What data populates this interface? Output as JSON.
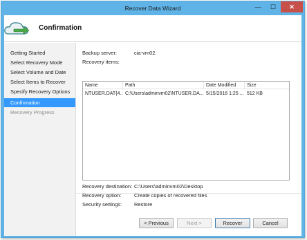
{
  "window": {
    "title": "Recover Data Wizard",
    "minimize_glyph": "—",
    "maximize_glyph": "☐",
    "close_glyph": "✕"
  },
  "header": {
    "title": "Confirmation",
    "icon": "cloud-recover-icon"
  },
  "nav": {
    "items": [
      {
        "label": "Getting Started",
        "state": "normal"
      },
      {
        "label": "Select Recovery Mode",
        "state": "normal"
      },
      {
        "label": "Select Volume and Date",
        "state": "normal"
      },
      {
        "label": "Select Items to Recover",
        "state": "normal"
      },
      {
        "label": "Specify Recovery Options",
        "state": "normal"
      },
      {
        "label": "Confirmation",
        "state": "active"
      },
      {
        "label": "Recovery Progress",
        "state": "disabled"
      }
    ]
  },
  "summary": {
    "backup_server_label": "Backup server:",
    "backup_server_value": "cia-vm02.",
    "recovery_items_label": "Recovery items:",
    "recovery_destination_label": "Recovery destination:",
    "recovery_destination_value": "C:\\Users\\adminvm02\\Desktop",
    "recovery_option_label": "Recovery option:",
    "recovery_option_value": "Create copies of recovered files",
    "security_settings_label": "Security settings:",
    "security_settings_value": "Restore"
  },
  "table": {
    "columns": [
      "Name",
      "Path",
      "Date Modified",
      "Size"
    ],
    "rows": [
      [
        "NTUSER.DAT{4...",
        "C:\\Users\\adminvm02\\NTUSER.DA...",
        "5/15/2016 1:25 ...",
        "512 KB"
      ]
    ]
  },
  "buttons": {
    "previous": "< Previous",
    "next": "Next >",
    "recover": "Recover",
    "cancel": "Cancel"
  },
  "colors": {
    "titlebar": "#5fb3e6",
    "nav_active": "#3399ff",
    "close_button": "#c7504b"
  }
}
